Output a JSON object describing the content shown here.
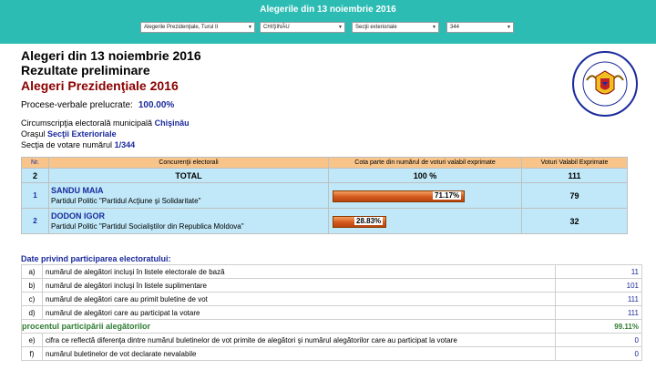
{
  "header": {
    "title": "Alegerile din 13 noiembrie 2016",
    "filters": [
      {
        "value": "Alegerile Prezidenţiale, Turul II"
      },
      {
        "value": "CHIŞINĂU"
      },
      {
        "value": "Secţii exterioriale"
      },
      {
        "value": "344"
      }
    ]
  },
  "main": {
    "heading1": "Alegeri din 13 noiembrie 2016",
    "heading2": "Rezultate preliminare",
    "heading3": "Alegeri Prezidenţiale 2016",
    "processed_label": "Procese-verbale prelucrate:",
    "processed_value": "100.00%",
    "circ_label": "Circumscripţia electorală municipală",
    "circ_value": "Chişinău",
    "city_label": "Oraşul",
    "city_value": "Secţii Exterioriale",
    "section_label": "Secţia de votare numărul",
    "section_value": "1/344"
  },
  "seal": {
    "icon": "cec-seal-icon",
    "text": "COMISIA ELECTORALĂ CENTRALĂ · REPUBLICA MOLDOVA"
  },
  "results": {
    "headers": [
      "Nr.",
      "Concurenţii electorali",
      "Cota parte din numărul de voturi valabil exprimate",
      "Voturi Valabil Exprimate"
    ],
    "total": {
      "nr": "2",
      "label": "TOTAL",
      "pct": "100 %",
      "votes": "111"
    },
    "candidates": [
      {
        "nr": "1",
        "name": "SANDU MAIA",
        "party": "Partidul Politic \"Partidul Acţiune şi Solidaritate\"",
        "pct_label": "71.17%",
        "pct": 71.17,
        "votes": "79"
      },
      {
        "nr": "2",
        "name": "DODON IGOR",
        "party": "Partidul Politic \"Partidul Socialiştilor din Republica Moldova\"",
        "pct_label": "28.83%",
        "pct": 28.83,
        "votes": "32"
      }
    ],
    "bar_color": "#d4581c"
  },
  "participation": {
    "title": "Date privind participarea electoratului:",
    "rows": [
      {
        "letter": "a)",
        "desc": "numărul de alegători incluşi în listele electorale de bază",
        "value": "11"
      },
      {
        "letter": "b)",
        "desc": "numărul de alegători incluşi în listele suplimentare",
        "value": "101"
      },
      {
        "letter": "c)",
        "desc": "numărul de alegători care au primit buletine de vot",
        "value": "111"
      },
      {
        "letter": "d)",
        "desc": "numărul de alegători care au participat la votare",
        "value": "111"
      }
    ],
    "pct_label": "procentul participării alegătorilor",
    "pct_value": "99.11%",
    "rows2": [
      {
        "letter": "e)",
        "desc": "cifra ce reflectă diferenţa dintre numărul buletinelor de vot primite de alegători şi numărul alegătorilor care au participat la votare",
        "value": "0"
      },
      {
        "letter": "f)",
        "desc": "numărul buletinelor de vot declarate nevalabile",
        "value": "0"
      }
    ]
  },
  "colors": {
    "topbar": "#2cbcb4",
    "header_cell": "#f8c489",
    "row_cell": "#c0e8f8",
    "link": "#1a2a9c"
  }
}
